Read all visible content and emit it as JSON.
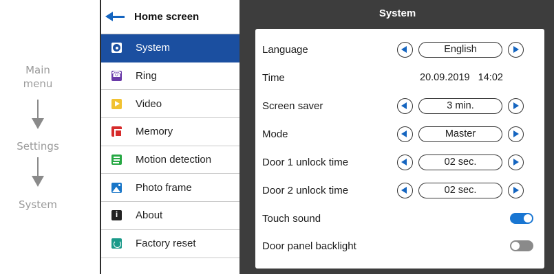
{
  "flow": {
    "step1": "Main menu",
    "step2": "Settings",
    "step3": "System"
  },
  "menu": {
    "header_title": "Home screen",
    "items": [
      {
        "label": "System",
        "icon": "gear-icon",
        "active": true
      },
      {
        "label": "Ring",
        "icon": "phone-icon"
      },
      {
        "label": "Video",
        "icon": "play-icon"
      },
      {
        "label": "Memory",
        "icon": "memory-icon"
      },
      {
        "label": "Motion detection",
        "icon": "motion-icon"
      },
      {
        "label": "Photo frame",
        "icon": "photo-icon"
      },
      {
        "label": "About",
        "icon": "info-icon"
      },
      {
        "label": "Factory reset",
        "icon": "reset-icon"
      }
    ]
  },
  "panel": {
    "title": "System",
    "language": {
      "label": "Language",
      "value": "English"
    },
    "time": {
      "label": "Time",
      "date": "20.09.2019",
      "clock": "14:02"
    },
    "screen_saver": {
      "label": "Screen saver",
      "value": "3 min."
    },
    "mode": {
      "label": "Mode",
      "value": "Master"
    },
    "door1": {
      "label": "Door 1 unlock time",
      "value": "02 sec."
    },
    "door2": {
      "label": "Door 2 unlock time",
      "value": "02 sec."
    },
    "touch_sound": {
      "label": "Touch sound",
      "enabled": true
    },
    "backlight": {
      "label": "Door panel backlight",
      "enabled": false
    }
  },
  "colors": {
    "accent": "#1b4fa0",
    "toggle_on": "#1976d2",
    "frame": "#3d3d3d"
  }
}
